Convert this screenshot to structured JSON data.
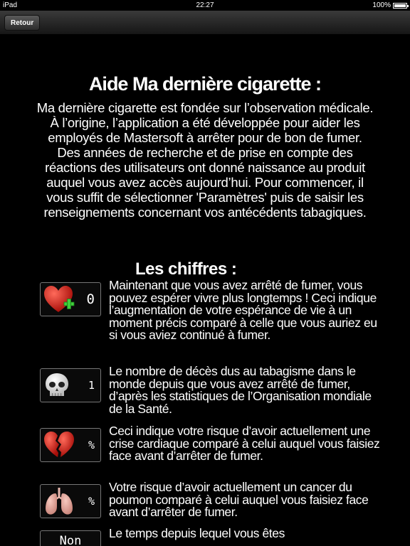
{
  "status_bar": {
    "device": "iPad",
    "time": "22:27",
    "battery": "100%",
    "battery_level": 1.0
  },
  "nav": {
    "back_label": "Retour"
  },
  "help": {
    "title": "Aide Ma dernière cigarette :",
    "intro": "Ma dernière cigarette est fondée sur l’observation médicale. À l’origine, l’application a été développée pour aider les employés de Mastersoft à arrêter pour de bon de fumer. Des années de recherche et de prise en compte des réactions des utilisateurs ont donné naissance au produit auquel vous avez accès aujourd’hui. Pour commencer, il vous suffit de sélectionner 'Paramètres' puis de saisir les renseignements concernant vos antécédents tabagiques.",
    "figures_title": "Les chiffres :"
  },
  "figures": [
    {
      "icon": "heart-plus-icon",
      "value": "0",
      "text": "Maintenant que vous avez arrêté de fumer, vous pouvez espérer vivre plus longtemps ! Ceci indique l’augmentation de votre espérance de vie à un moment précis comparé à celle que vous auriez eu si vous aviez continué à fumer."
    },
    {
      "icon": "skull-icon",
      "value": "1",
      "text": "Le nombre de décès dus au tabagisme dans le monde depuis que vous avez arrêté de fumer, d’après les statistiques de l’Organisation mondiale de la Santé."
    },
    {
      "icon": "broken-heart-icon",
      "value": "%",
      "text": "Ceci indique votre risque d’avoir actuellement une crise cardiaque comparé à celui auquel vous faisiez face avant d’arrêter de fumer."
    },
    {
      "icon": "lungs-icon",
      "value": "%",
      "text": "Votre risque d’avoir actuellement un cancer du poumon comparé à celui auquel vous faisiez face avant d’arrêter de fumer."
    },
    {
      "icon": "",
      "value": "Non",
      "text": "Le temps depuis lequel vous êtes"
    }
  ]
}
